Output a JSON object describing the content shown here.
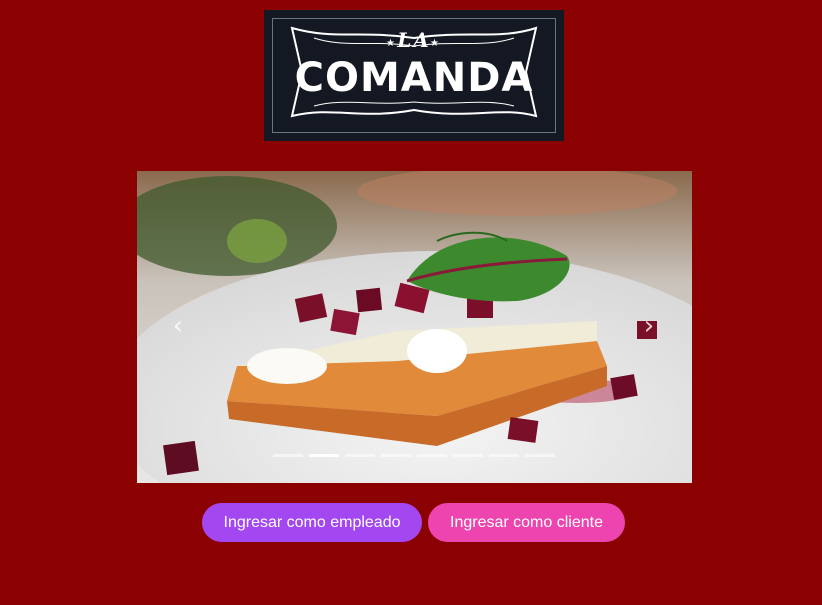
{
  "logo": {
    "small_text": "LA",
    "big_text": "COMANDA",
    "colors": {
      "background": "#141822",
      "ink": "#ffffff"
    }
  },
  "carousel": {
    "image": "plated-dish-photo",
    "prev_icon": "chevron-left-icon",
    "next_icon": "chevron-right-icon",
    "prev_glyph": "‹",
    "next_glyph": "›",
    "indicator_count": 8,
    "active_index": 1
  },
  "buttons": {
    "empleado_label": "Ingresar como empleado",
    "cliente_label": "Ingresar como cliente"
  },
  "colors": {
    "page_background": "#8b0000",
    "empleado_button": "#a347f0",
    "cliente_button": "#ee44b0"
  }
}
